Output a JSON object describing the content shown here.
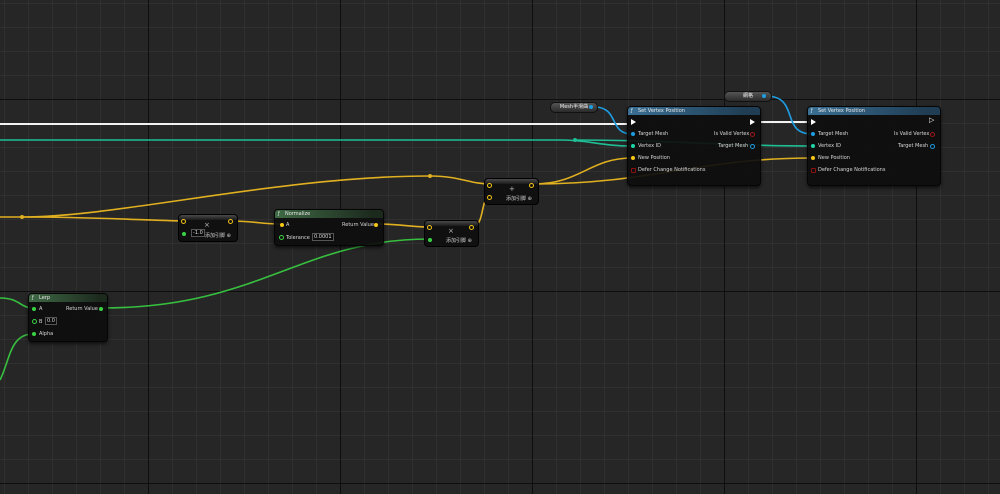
{
  "colors": {
    "exec": "#ffffff",
    "vector": "#f5c518",
    "float": "#3ad344",
    "object": "#1ea3e6",
    "integer": "#1fd6a8",
    "boolean": "#8c1010",
    "grid_background": "#262626"
  },
  "vars": {
    "mesh_smooth": "Mesh半滑曲",
    "mesh_alt": "網格"
  },
  "set_vertex_1": {
    "title": "Set Vertex Position",
    "target_mesh": "Target Mesh",
    "is_valid_vertex": "Is Valid Vertex",
    "vertex_id": "Vertex ID",
    "target_mesh_out": "Target Mesh",
    "new_position": "New Position",
    "defer": "Defer Change Notifications"
  },
  "set_vertex_2": {
    "title": "Set Vertex Position",
    "target_mesh": "Target Mesh",
    "is_valid_vertex": "Is Valid Vertex",
    "vertex_id": "Vertex ID",
    "target_mesh_out": "Target Mesh",
    "new_position": "New Position",
    "defer": "Defer Change Notifications"
  },
  "multiply_1": {
    "operator": "×",
    "value": "-1.0",
    "add_pin": "添加引脚"
  },
  "normalize": {
    "title": "Normalize",
    "a": "A",
    "return_value": "Return Value",
    "tolerance": "Tolerance",
    "tolerance_value": "0.0001"
  },
  "multiply_2": {
    "operator": "×",
    "add_pin": "添加引脚"
  },
  "add": {
    "operator": "+",
    "add_pin": "添加引脚"
  },
  "lerp": {
    "title": "Lerp",
    "a": "A",
    "b": "B",
    "b_value": "0.0",
    "alpha": "Alpha",
    "return_value": "Return Value"
  }
}
